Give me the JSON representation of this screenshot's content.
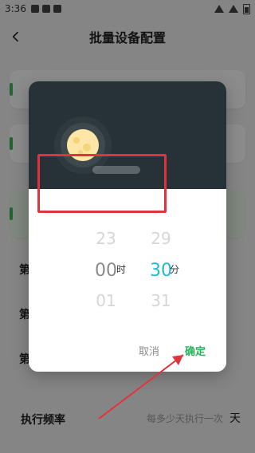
{
  "status": {
    "time": "3:36"
  },
  "header": {
    "title": "批量设备配置"
  },
  "labels": {
    "first": "第",
    "second": "第",
    "third": "第"
  },
  "frequency": {
    "label": "执行频率",
    "placeholder": "每多少天执行一次",
    "unit": "天"
  },
  "dialog": {
    "hour": {
      "prev": "23",
      "current": "00",
      "next": "01",
      "unit": "时"
    },
    "minute": {
      "prev": "29",
      "current": "30",
      "next": "31",
      "unit": "分"
    },
    "actions": {
      "cancel": "取消",
      "confirm": "确定"
    }
  },
  "icons": {
    "back": "back-arrow-icon",
    "moon": "moon-icon"
  },
  "colors": {
    "confirm": "#27b15a",
    "minute_highlight": "#1fbad6",
    "annotation": "#e2333b"
  }
}
